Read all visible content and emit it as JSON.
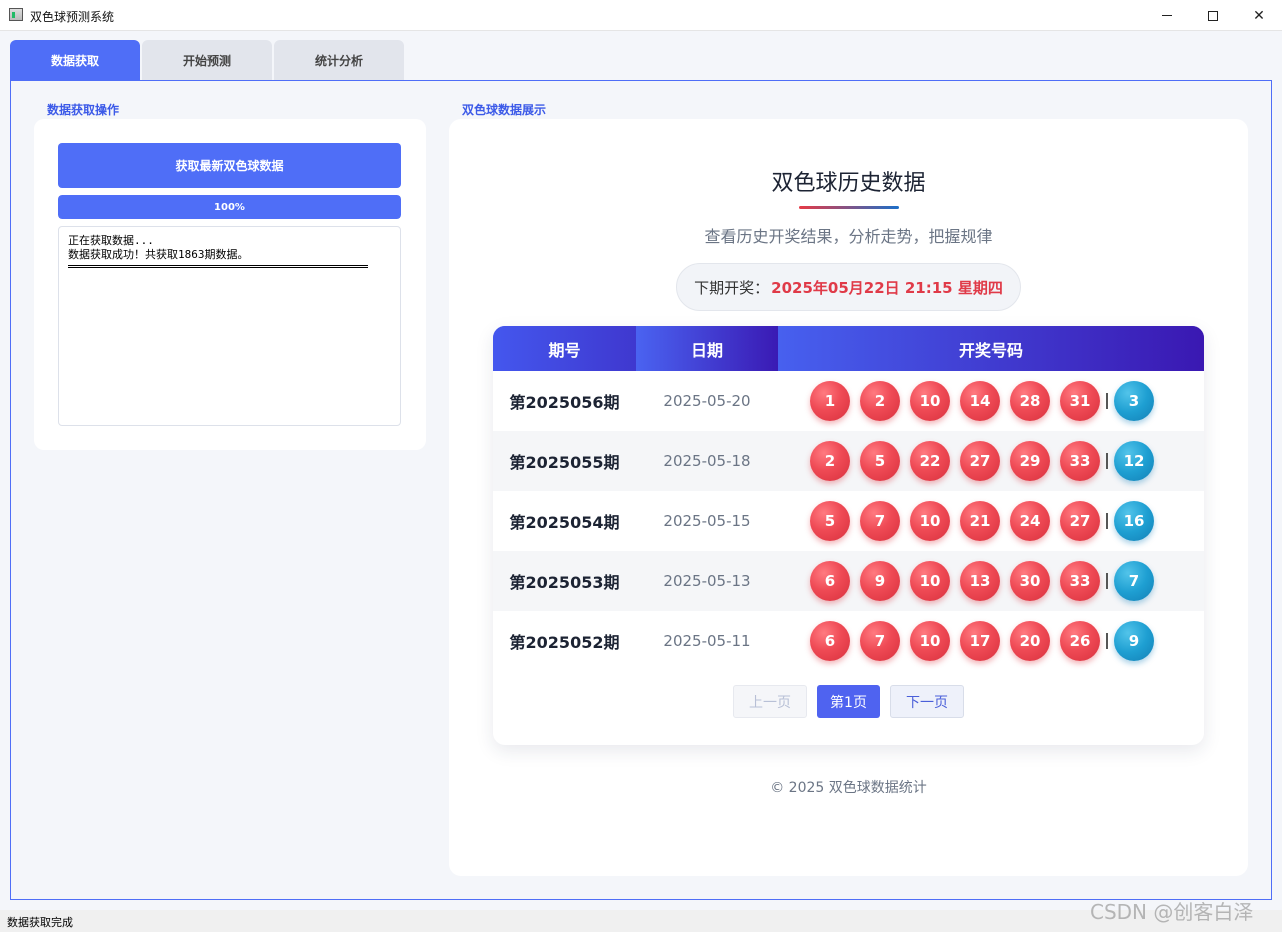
{
  "window": {
    "title": "双色球预测系统"
  },
  "tabs": [
    {
      "label": "数据获取",
      "active": true
    },
    {
      "label": "开始预测",
      "active": false
    },
    {
      "label": "统计分析",
      "active": false
    }
  ],
  "left": {
    "group_label": "数据获取操作",
    "fetch_button": "获取最新双色球数据",
    "progress": {
      "value": 1.0,
      "label": "100%"
    },
    "log": [
      "正在获取数据...",
      "数据获取成功！共获取1863期数据。"
    ]
  },
  "right": {
    "group_label": "双色球数据展示",
    "title": "双色球历史数据",
    "subtitle": "查看历史开奖结果，分析走势，把握规律",
    "next_draw": {
      "label": "下期开奖：",
      "value": "2025年05月22日 21:15 星期四"
    },
    "table": {
      "headers": [
        "期号",
        "日期",
        "开奖号码"
      ],
      "rows": [
        {
          "issue": "第2025056期",
          "date": "2025-05-20",
          "red": [
            "1",
            "2",
            "10",
            "14",
            "28",
            "31"
          ],
          "blue": "3"
        },
        {
          "issue": "第2025055期",
          "date": "2025-05-18",
          "red": [
            "2",
            "5",
            "22",
            "27",
            "29",
            "33"
          ],
          "blue": "12"
        },
        {
          "issue": "第2025054期",
          "date": "2025-05-15",
          "red": [
            "5",
            "7",
            "10",
            "21",
            "24",
            "27"
          ],
          "blue": "16"
        },
        {
          "issue": "第2025053期",
          "date": "2025-05-13",
          "red": [
            "6",
            "9",
            "10",
            "13",
            "30",
            "33"
          ],
          "blue": "7"
        },
        {
          "issue": "第2025052期",
          "date": "2025-05-11",
          "red": [
            "6",
            "7",
            "10",
            "17",
            "20",
            "26"
          ],
          "blue": "9"
        }
      ]
    },
    "pager": {
      "prev": "上一页",
      "current": "第1页",
      "next": "下一页"
    },
    "footer": "© 2025 双色球数据统计"
  },
  "status": "数据获取完成",
  "watermark": "CSDN @创客白泽",
  "colors": {
    "accent": "#4f6ef7",
    "red_ball": "#ef4a55",
    "blue_ball": "#1e9fd2",
    "highlight": "#e03a48"
  }
}
